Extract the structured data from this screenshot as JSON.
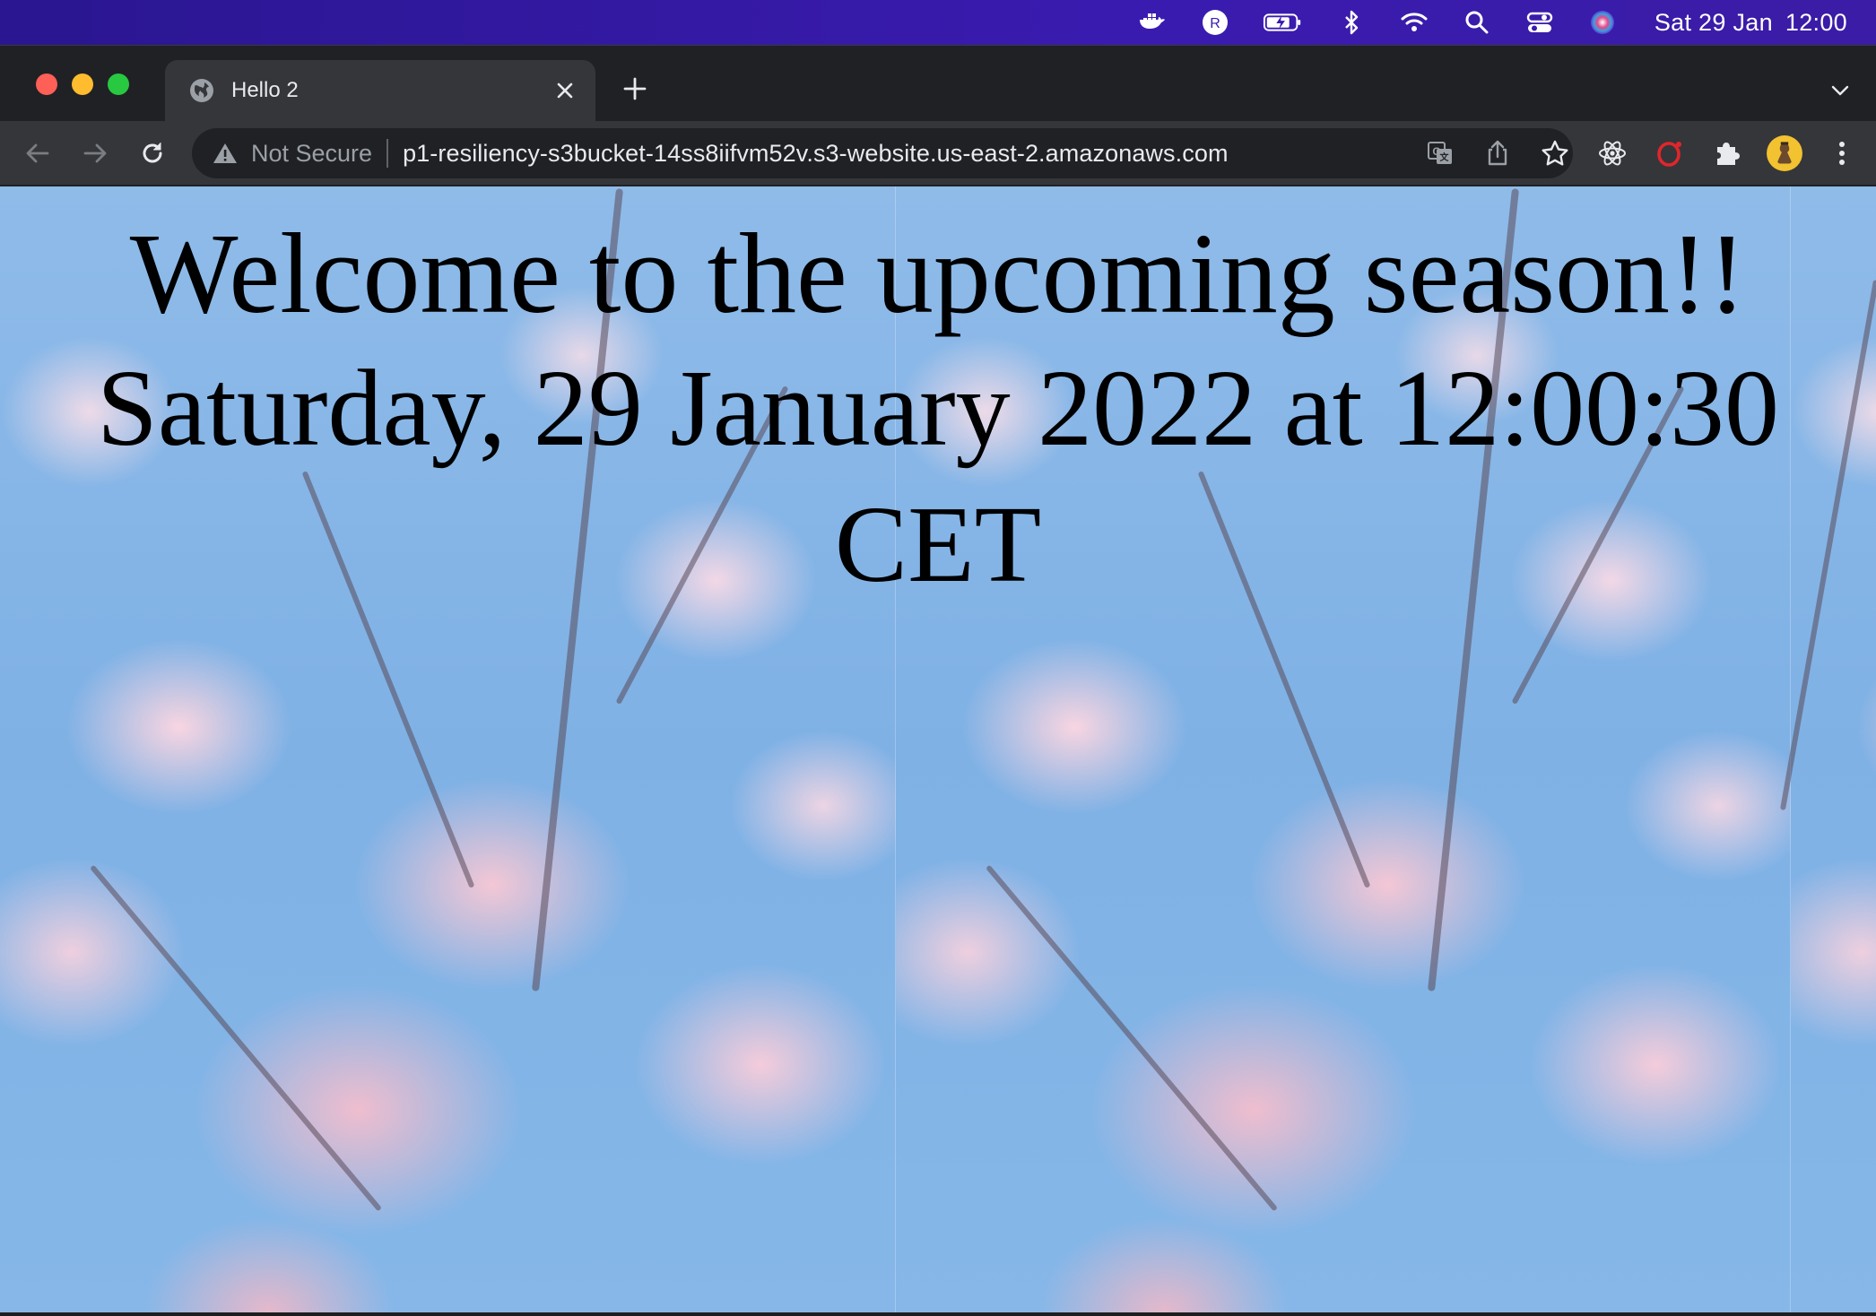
{
  "menubar": {
    "icons": [
      "docker-icon",
      "r-app-icon",
      "battery-charging-icon",
      "bluetooth-icon",
      "wifi-icon",
      "spotlight-search-icon",
      "control-center-icon",
      "siri-icon"
    ],
    "date": "Sat 29 Jan",
    "time": "12:00"
  },
  "browser": {
    "tab": {
      "title": "Hello 2"
    },
    "address_bar": {
      "security_label": "Not Secure",
      "url": "p1-resiliency-s3bucket-14ss8iifvm52v.s3-website.us-east-2.amazonaws.com"
    },
    "extensions": [
      "react-devtools-icon",
      "opera-icon",
      "extensions-puzzle-icon"
    ]
  },
  "page": {
    "heading": "Welcome to the upcoming season!!",
    "datetime": "Saturday, 29 January 2022 at 12:00:30 CET",
    "background": "cherry blossom photo tiled horizontally"
  },
  "colors": {
    "menubar": "#2a1690",
    "tabstrip": "#202124",
    "toolbar": "#35363a",
    "omnibox": "#202124",
    "sky": "#7fb1e5",
    "blossom": "#f7c9d6"
  }
}
